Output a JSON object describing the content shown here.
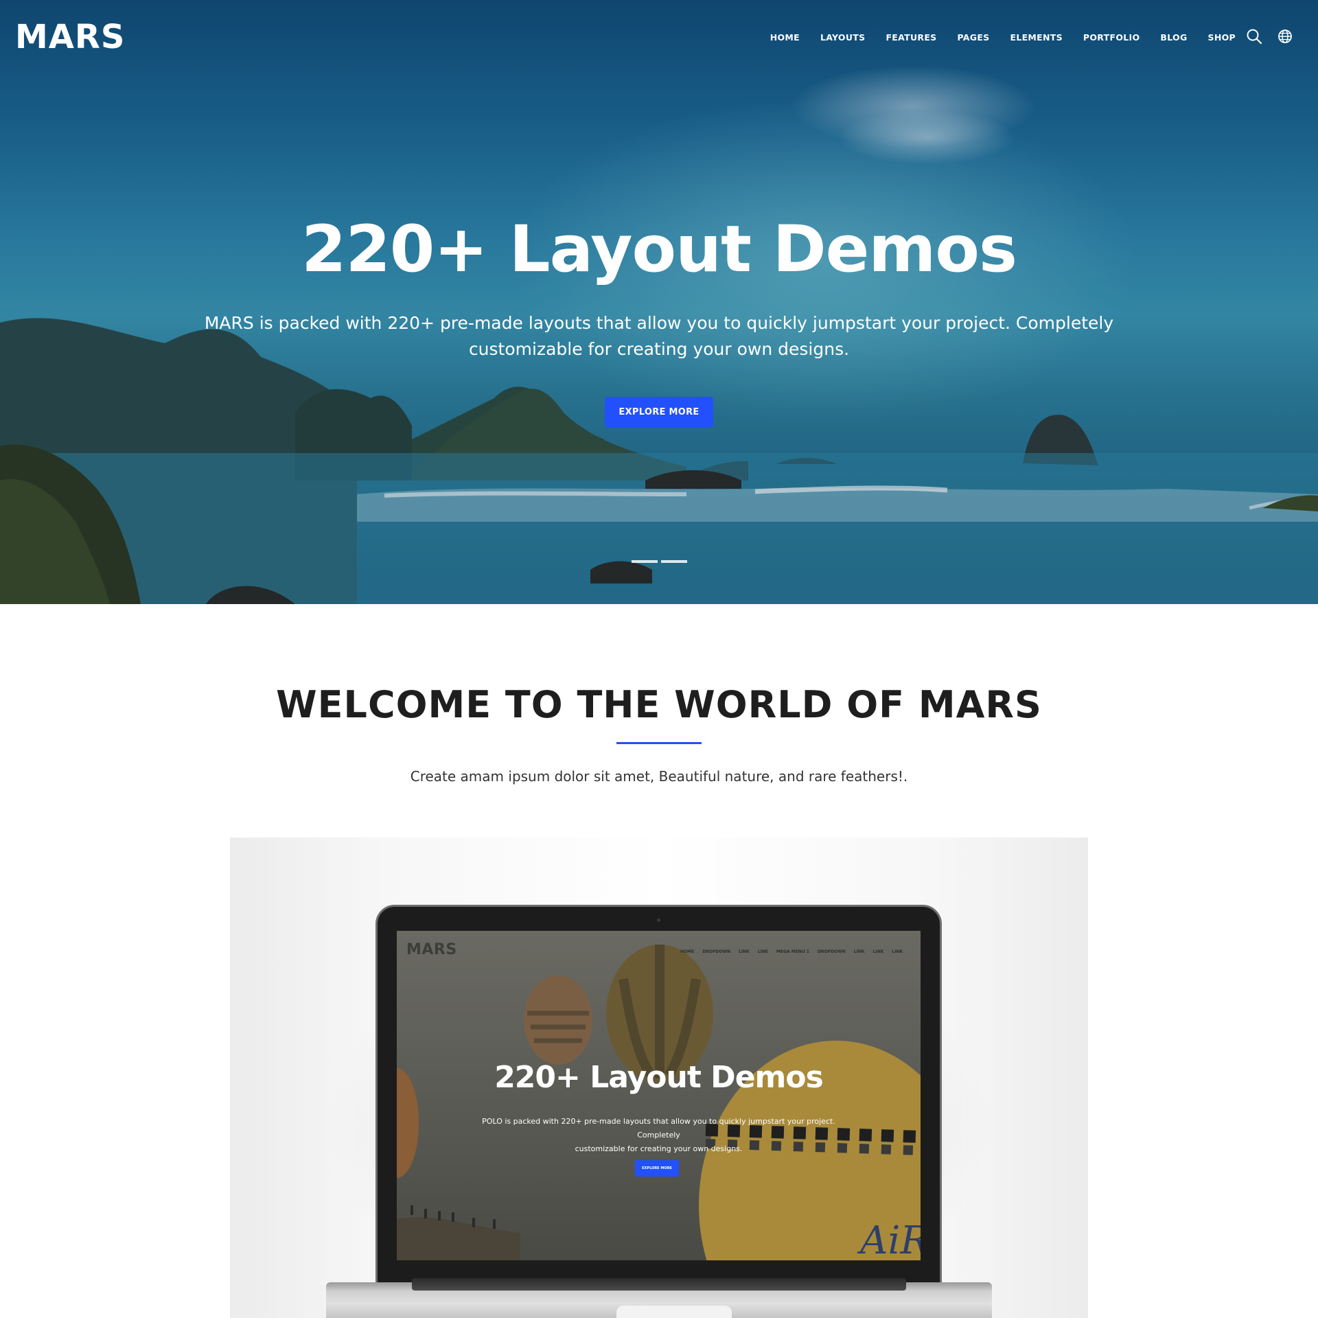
{
  "header": {
    "logo": "MARS",
    "nav": [
      "HOME",
      "LAYOUTS",
      "FEATURES",
      "PAGES",
      "ELEMENTS",
      "PORTFOLIO",
      "BLOG",
      "SHOP"
    ],
    "icons": [
      "search-icon",
      "globe-icon"
    ]
  },
  "hero": {
    "title": "220+ Layout Demos",
    "subtitle_line1": "MARS is packed with 220+ pre-made layouts that allow you to quickly jumpstart your project. Completely",
    "subtitle_line2": "customizable for creating your own designs.",
    "button": "EXPLORE MORE",
    "slide_count": 2
  },
  "welcome": {
    "title": "WELCOME TO THE WORLD OF MARS",
    "text": "Create amam ipsum dolor sit amet, Beautiful nature, and rare feathers!."
  },
  "mockup": {
    "logo": "MARS",
    "nav": [
      "HOME",
      "DROPDOWN",
      "LINK",
      "LINE",
      "MEGA MENU 1",
      "DROPDOWN",
      "LINK",
      "LINK",
      "LINK"
    ],
    "title": "220+ Layout Demos",
    "subtitle_line1": "POLO is packed with 220+ pre-made layouts that allow you to quickly jumpstart your project. Completely",
    "subtitle_line2": "customizable for creating your own designs.",
    "button": "EXPLORE MORE",
    "balloon_text": "AiR"
  },
  "colors": {
    "accent": "#2250fc",
    "hero_sea": "#2f87ad",
    "text_dark": "#1e1e1e"
  }
}
